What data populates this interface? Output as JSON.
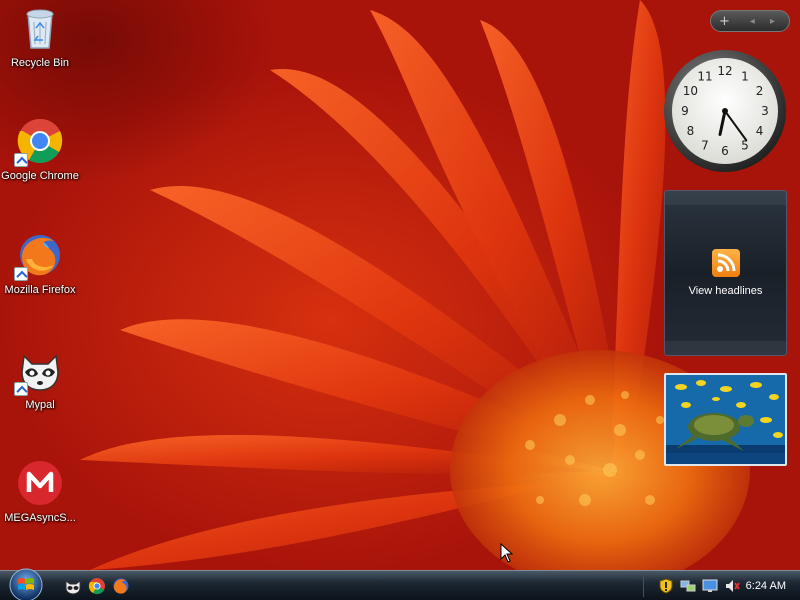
{
  "desktop": {
    "icons": [
      {
        "label": "Recycle Bin"
      },
      {
        "label": "Google Chrome"
      },
      {
        "label": "Mozilla Firefox"
      },
      {
        "label": "Mypal"
      },
      {
        "label": "MEGAsyncS..."
      }
    ]
  },
  "sidebar": {
    "controls": {
      "add_label": "+",
      "nav_label": "◂ ▸"
    },
    "clock": {
      "hour": 6,
      "minute": 24
    },
    "feed": {
      "label": "View headlines"
    }
  },
  "taskbar": {
    "quick_launch": [
      "mypal-icon",
      "chrome-icon",
      "firefox-icon"
    ],
    "tray_icons": [
      "security-shield-icon",
      "network-icon",
      "display-icon",
      "speaker-muted-icon"
    ],
    "clock": "6:24 AM"
  },
  "colors": {
    "wallpaper": "#c3200c",
    "taskbar": "#0b131b",
    "rss": "#f07e10"
  }
}
